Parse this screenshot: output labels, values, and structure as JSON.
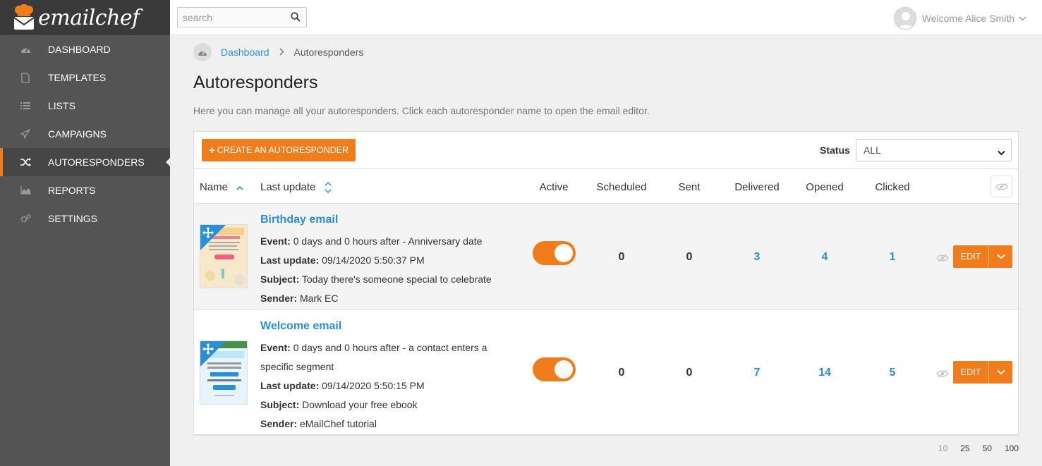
{
  "brand": {
    "name": "emailchef"
  },
  "sidebar": {
    "items": [
      {
        "label": "DASHBOARD",
        "icon": "dashboard-icon"
      },
      {
        "label": "TEMPLATES",
        "icon": "file-icon"
      },
      {
        "label": "LISTS",
        "icon": "list-icon"
      },
      {
        "label": "CAMPAIGNS",
        "icon": "paper-plane-icon"
      },
      {
        "label": "AUTORESPONDERS",
        "icon": "shuffle-icon",
        "active": true
      },
      {
        "label": "REPORTS",
        "icon": "area-chart-icon"
      },
      {
        "label": "SETTINGS",
        "icon": "gears-icon"
      }
    ]
  },
  "topbar": {
    "search_placeholder": "search",
    "user_greeting": "Welcome Alice Smith"
  },
  "breadcrumb": {
    "home": "Dashboard",
    "current": "Autoresponders"
  },
  "page": {
    "title": "Autoresponders",
    "description": "Here you can manage all your autoresponders. Click each autoresponder name to open the email editor."
  },
  "toolbar": {
    "create_label": "CREATE AN AUTORESPONDER",
    "status_label": "Status",
    "status_value": "ALL"
  },
  "table": {
    "columns": {
      "name": "Name",
      "last_update": "Last update",
      "active": "Active",
      "scheduled": "Scheduled",
      "sent": "Sent",
      "delivered": "Delivered",
      "opened": "Opened",
      "clicked": "Clicked"
    },
    "labels": {
      "event": "Event:",
      "last_update": "Last update:",
      "subject": "Subject:",
      "sender": "Sender:",
      "edit": "EDIT"
    },
    "rows": [
      {
        "name": "Birthday email",
        "event": "0 days and 0 hours after - Anniversary date",
        "last_update": "09/14/2020 5:50:37 PM",
        "subject": "Today there's someone special to celebrate",
        "sender": "Mark EC",
        "active": true,
        "scheduled": "0",
        "sent": "0",
        "delivered": "3",
        "opened": "4",
        "clicked": "1"
      },
      {
        "name": "Welcome email",
        "event": "0 days and 0 hours after - a contact enters a specific segment",
        "last_update": "09/14/2020 5:50:15 PM",
        "subject": "Download your free ebook",
        "sender": "eMailChef tutorial",
        "active": true,
        "scheduled": "0",
        "sent": "0",
        "delivered": "7",
        "opened": "14",
        "clicked": "5"
      }
    ]
  },
  "pager": {
    "options": [
      "10",
      "25",
      "50",
      "100"
    ],
    "current": "10"
  },
  "colors": {
    "accent": "#f07c1b",
    "link": "#2b8fd6",
    "sidebar": "#545454",
    "sidebar_dark": "#3a3a3a"
  }
}
